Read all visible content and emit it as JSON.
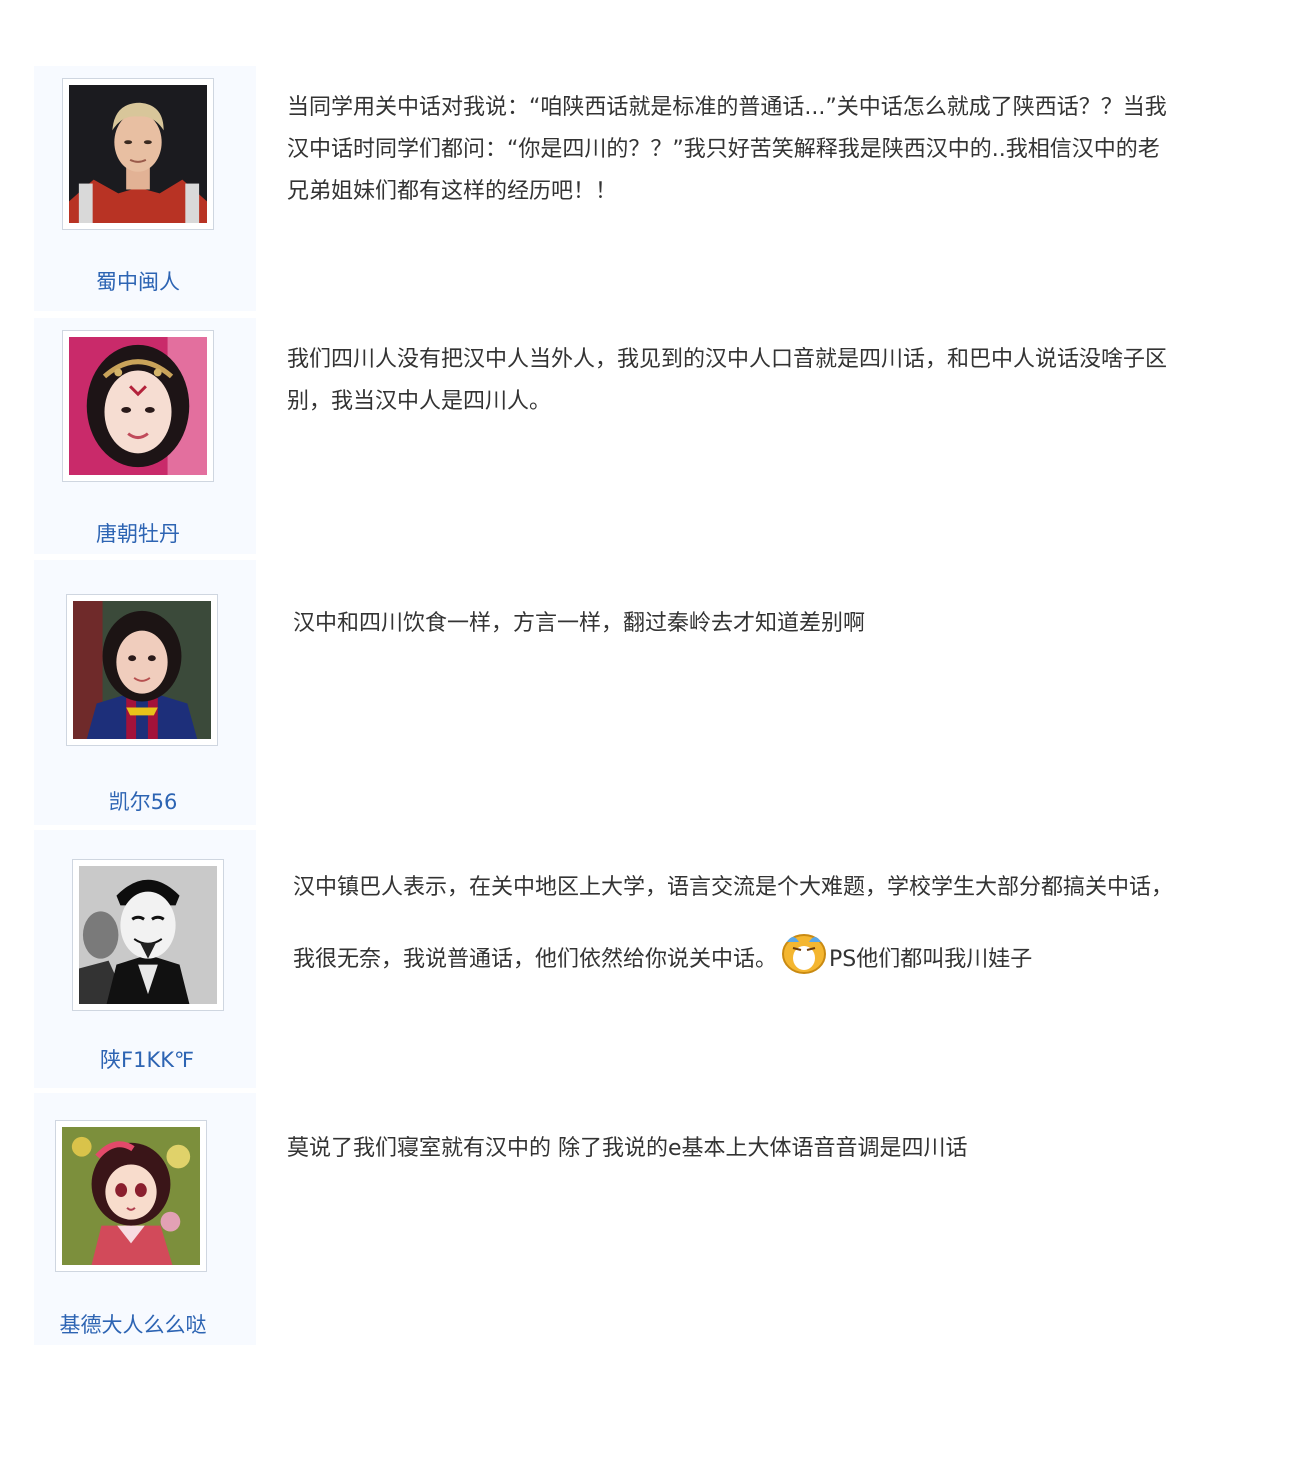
{
  "posts": [
    {
      "username": "蜀中闽人",
      "lines": [
        "当同学用关中话对我说：“咱陕西话就是标准的普通话...”关中话怎么就成了陕西话？？当我",
        "汉中话时同学们都问：“你是四川的？？”我只好苦笑解释我是陕西汉中的..我相信汉中的老",
        "兄弟姐妹们都有这样的经历吧！！"
      ],
      "avatar_icon": "avatar-blond-man-icon"
    },
    {
      "username": "唐朝牡丹",
      "lines": [
        "我们四川人没有把汉中人当外人，我见到的汉中人口音就是四川话，和巴中人说话没啥子区",
        "别，我当汉中人是四川人。"
      ],
      "avatar_icon": "avatar-costume-woman-icon"
    },
    {
      "username": "凯尔56",
      "lines": [
        "汉中和四川饮食一样，方言一样，翻过秦岭去才知道差别啊"
      ],
      "avatar_icon": "avatar-girl-jersey-icon"
    },
    {
      "username": "陕F1KK℉",
      "lines": [
        "汉中镇巴人表示，在关中地区上大学，语言交流是个大难题，学校学生大部分都搞关中话，"
      ],
      "line2_before_emoji": "我很无奈，我说普通话，他们依然给你说关中话。",
      "line2_after_emoji": "PS他们都叫我川娃子",
      "emoji_icon": "crying-face-emoji-icon",
      "avatar_icon": "avatar-masked-man-icon"
    },
    {
      "username": "基德大人么么哒",
      "lines": [
        "莫说了我们寝室就有汉中的 除了我说的e基本上大体语音音调是四川话"
      ],
      "avatar_icon": "avatar-anime-girl-icon"
    }
  ],
  "colors": {
    "username": "#2d64b3",
    "text": "#333333",
    "sidebar": "#f7faff"
  }
}
